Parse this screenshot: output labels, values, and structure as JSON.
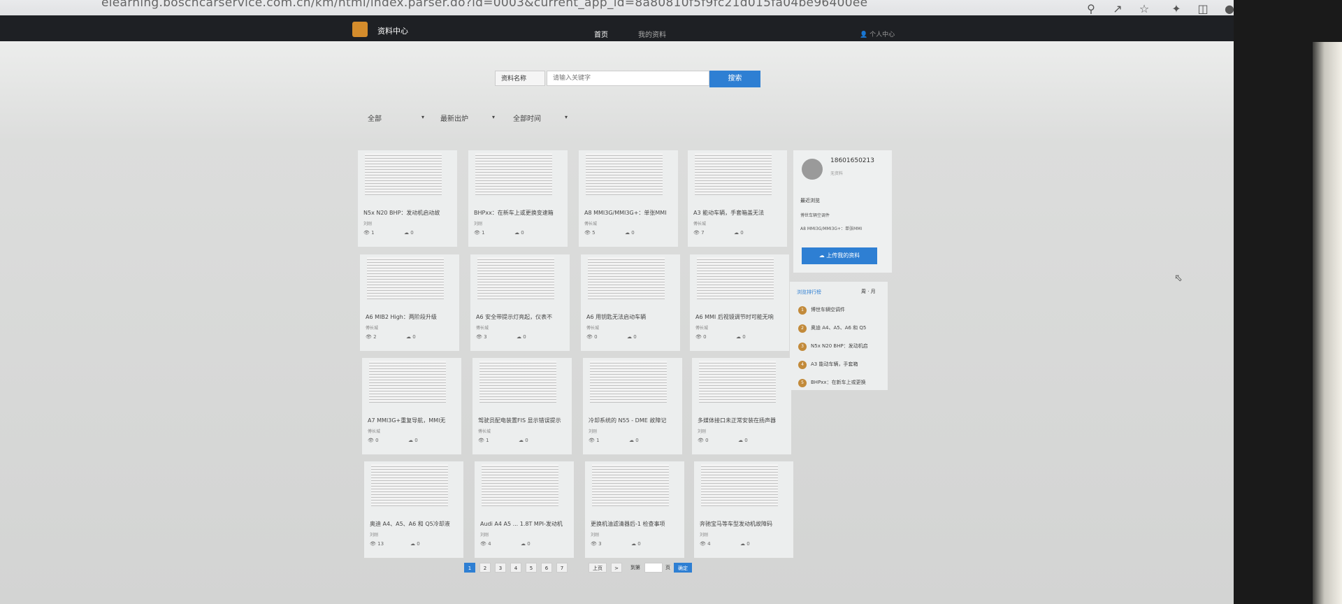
{
  "browser": {
    "url": "elearning.boschcarservice.com.cn/km/html/index.parser.do?id=0003&current_app_id=8a80810f5f9fc21d015fa04be96400ee"
  },
  "header": {
    "app_name": "资料中心",
    "nav": [
      {
        "label": "首页"
      },
      {
        "label": "我的资料"
      }
    ],
    "user_label": "个人中心"
  },
  "search": {
    "type_label": "资料名称",
    "placeholder": "请输入关键字",
    "button": "搜索"
  },
  "filters": [
    {
      "label": "全部"
    },
    {
      "label": "最新出炉"
    },
    {
      "label": "全部时间"
    }
  ],
  "cards": [
    {
      "title": "N5x N20 BHP：发动机启动故",
      "author": "刘刚",
      "views": "1",
      "downloads": "0"
    },
    {
      "title": "BHPxx：在新车上或更换变速箱",
      "author": "刘刚",
      "views": "1",
      "downloads": "0"
    },
    {
      "title": "A8 MMI3G/MMI3G+：单张MMI",
      "author": "傅长城",
      "views": "5",
      "downloads": "0"
    },
    {
      "title": "A3 能动车辆，手套箱盖无法",
      "author": "傅长城",
      "views": "7",
      "downloads": "0"
    },
    {
      "title": "A6 MIB2 High：两阶段升级",
      "author": "傅长城",
      "views": "2",
      "downloads": "0"
    },
    {
      "title": "A6 安全带提示灯亮起，仪表不",
      "author": "傅长城",
      "views": "3",
      "downloads": "0"
    },
    {
      "title": "A6 用钥匙无法启动车辆",
      "author": "傅长城",
      "views": "0",
      "downloads": "0"
    },
    {
      "title": "A6 MMI 后视镜调节时可能无响",
      "author": "傅长城",
      "views": "0",
      "downloads": "0"
    },
    {
      "title": "A7 MMI3G+重复导航，MMI无",
      "author": "傅长城",
      "views": "0",
      "downloads": "0"
    },
    {
      "title": "驾驶员配电装置FIS 显示错误提示",
      "author": "傅长城",
      "views": "1",
      "downloads": "0"
    },
    {
      "title": "冷却系统的 N55 - DME 故障记",
      "author": "刘刚",
      "views": "1",
      "downloads": "0"
    },
    {
      "title": "多媒体接口未正常安装在扬声器",
      "author": "刘刚",
      "views": "0",
      "downloads": "0"
    },
    {
      "title": "奥迪 A4、A5、A6 和 Q5冷却液",
      "author": "刘刚",
      "views": "13",
      "downloads": "0"
    },
    {
      "title": "Audi A4 A5 ... 1.8T MPI-发动机",
      "author": "刘刚",
      "views": "4",
      "downloads": "0"
    },
    {
      "title": "更换机油滤清器后-1 检查事项",
      "author": "刘刚",
      "views": "3",
      "downloads": "0"
    },
    {
      "title": "奔驰宝马等车型发动机故障码",
      "author": "刘刚",
      "views": "4",
      "downloads": "0"
    }
  ],
  "profile": {
    "user_id": "18601650213",
    "subtitle": "无资料",
    "recent_heading": "最近浏览",
    "recent": [
      "博世车辆空调件",
      "A8 MMI3G/MMI3G+：单张MMI"
    ],
    "upload_button": "上传我的资料"
  },
  "ranking": {
    "heading": "浏览排行榜",
    "tabs": "周 · 月",
    "items": [
      {
        "rank": "1",
        "title": "博世车辆空调件"
      },
      {
        "rank": "2",
        "title": "奥迪 A4、A5、A6 和 Q5"
      },
      {
        "rank": "3",
        "title": "N5x N20 BHP：发动机启"
      },
      {
        "rank": "4",
        "title": "A3 能动车辆，手套箱"
      },
      {
        "rank": "5",
        "title": "BHPxx：在新车上或更换"
      }
    ]
  },
  "pagination": {
    "pages": [
      "1",
      "2",
      "3",
      "4",
      "5",
      "6",
      "7"
    ],
    "prev": "上页",
    "next": ">",
    "goto_label": "到第",
    "page_unit": "页",
    "go_button": "确定"
  }
}
